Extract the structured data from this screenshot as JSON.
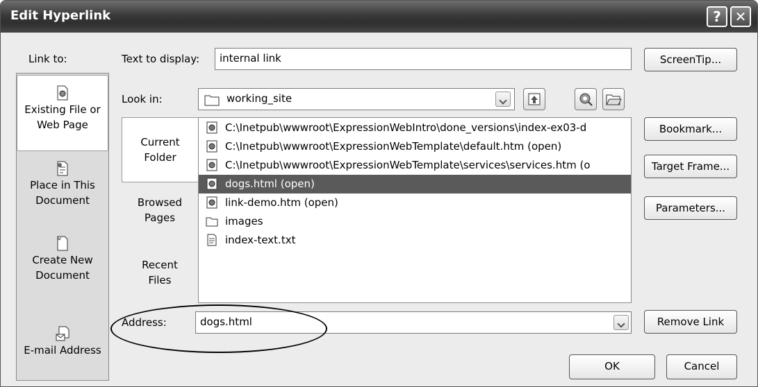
{
  "dialog": {
    "title": "Edit Hyperlink",
    "help_glyph": "?",
    "close_glyph": "✕"
  },
  "link_to": {
    "label": "Link to:",
    "items": [
      {
        "line1": "Existing File or",
        "line2": "Web Page"
      },
      {
        "line1": "Place in This",
        "line2": "Document"
      },
      {
        "line1": "Create New",
        "line2": "Document"
      },
      {
        "line1": "E-mail Address",
        "line2": ""
      }
    ]
  },
  "text_to_display": {
    "label": "Text to display:",
    "value": "internal link"
  },
  "screentip_label": "ScreenTip...",
  "look_in": {
    "label": "Look in:",
    "value": "working_site"
  },
  "side_tabs": [
    {
      "line1": "Current",
      "line2": "Folder"
    },
    {
      "line1": "Browsed",
      "line2": "Pages"
    },
    {
      "line1": "Recent",
      "line2": "Files"
    }
  ],
  "files": [
    {
      "name": "C:\\Inetpub\\wwwroot\\ExpressionWebIntro\\done_versions\\index-ex03-d",
      "icon": "web-page-icon"
    },
    {
      "name": "C:\\Inetpub\\wwwroot\\ExpressionWebTemplate\\default.htm (open)",
      "icon": "web-page-icon"
    },
    {
      "name": "C:\\Inetpub\\wwwroot\\ExpressionWebTemplate\\services\\services.htm (o",
      "icon": "web-page-icon"
    },
    {
      "name": "dogs.html (open)",
      "icon": "web-page-icon"
    },
    {
      "name": "link-demo.htm (open)",
      "icon": "web-page-icon"
    },
    {
      "name": "images",
      "icon": "folder-icon"
    },
    {
      "name": "index-text.txt",
      "icon": "text-file-icon"
    }
  ],
  "right_buttons": {
    "bookmark": "Bookmark...",
    "target_frame": "Target Frame...",
    "parameters": "Parameters...",
    "remove_link": "Remove Link"
  },
  "address": {
    "label": "Address:",
    "value": "dogs.html"
  },
  "ok_label": "OK",
  "cancel_label": "Cancel"
}
